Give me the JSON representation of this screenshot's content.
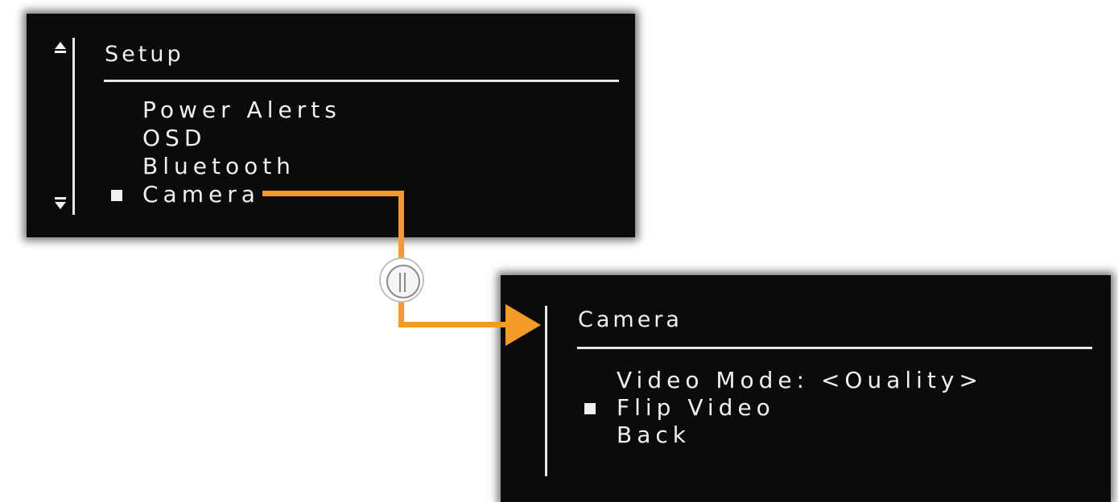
{
  "setup_menu": {
    "title": "Setup",
    "items": [
      {
        "label": "Power Alerts",
        "selected": false
      },
      {
        "label": "OSD",
        "selected": false
      },
      {
        "label": "Bluetooth",
        "selected": false
      },
      {
        "label": "Camera",
        "selected": true
      }
    ],
    "scroll_up_icon": "triangle-up-icon",
    "scroll_down_icon": "triangle-down-icon"
  },
  "camera_menu": {
    "title": "Camera",
    "items": [
      {
        "label": "Video Mode: <Ouality>",
        "selected": false
      },
      {
        "label": "Flip Video",
        "selected": true
      },
      {
        "label": "Back",
        "selected": false
      }
    ]
  },
  "colors": {
    "panel_background": "#0b0b0d",
    "text": "#f0f0f0",
    "connector": "#f39a2a"
  },
  "icons": {
    "knob": "control-knob-icon",
    "selection": "square-bullet-icon",
    "connector_arrow": "orange-arrow-icon"
  }
}
